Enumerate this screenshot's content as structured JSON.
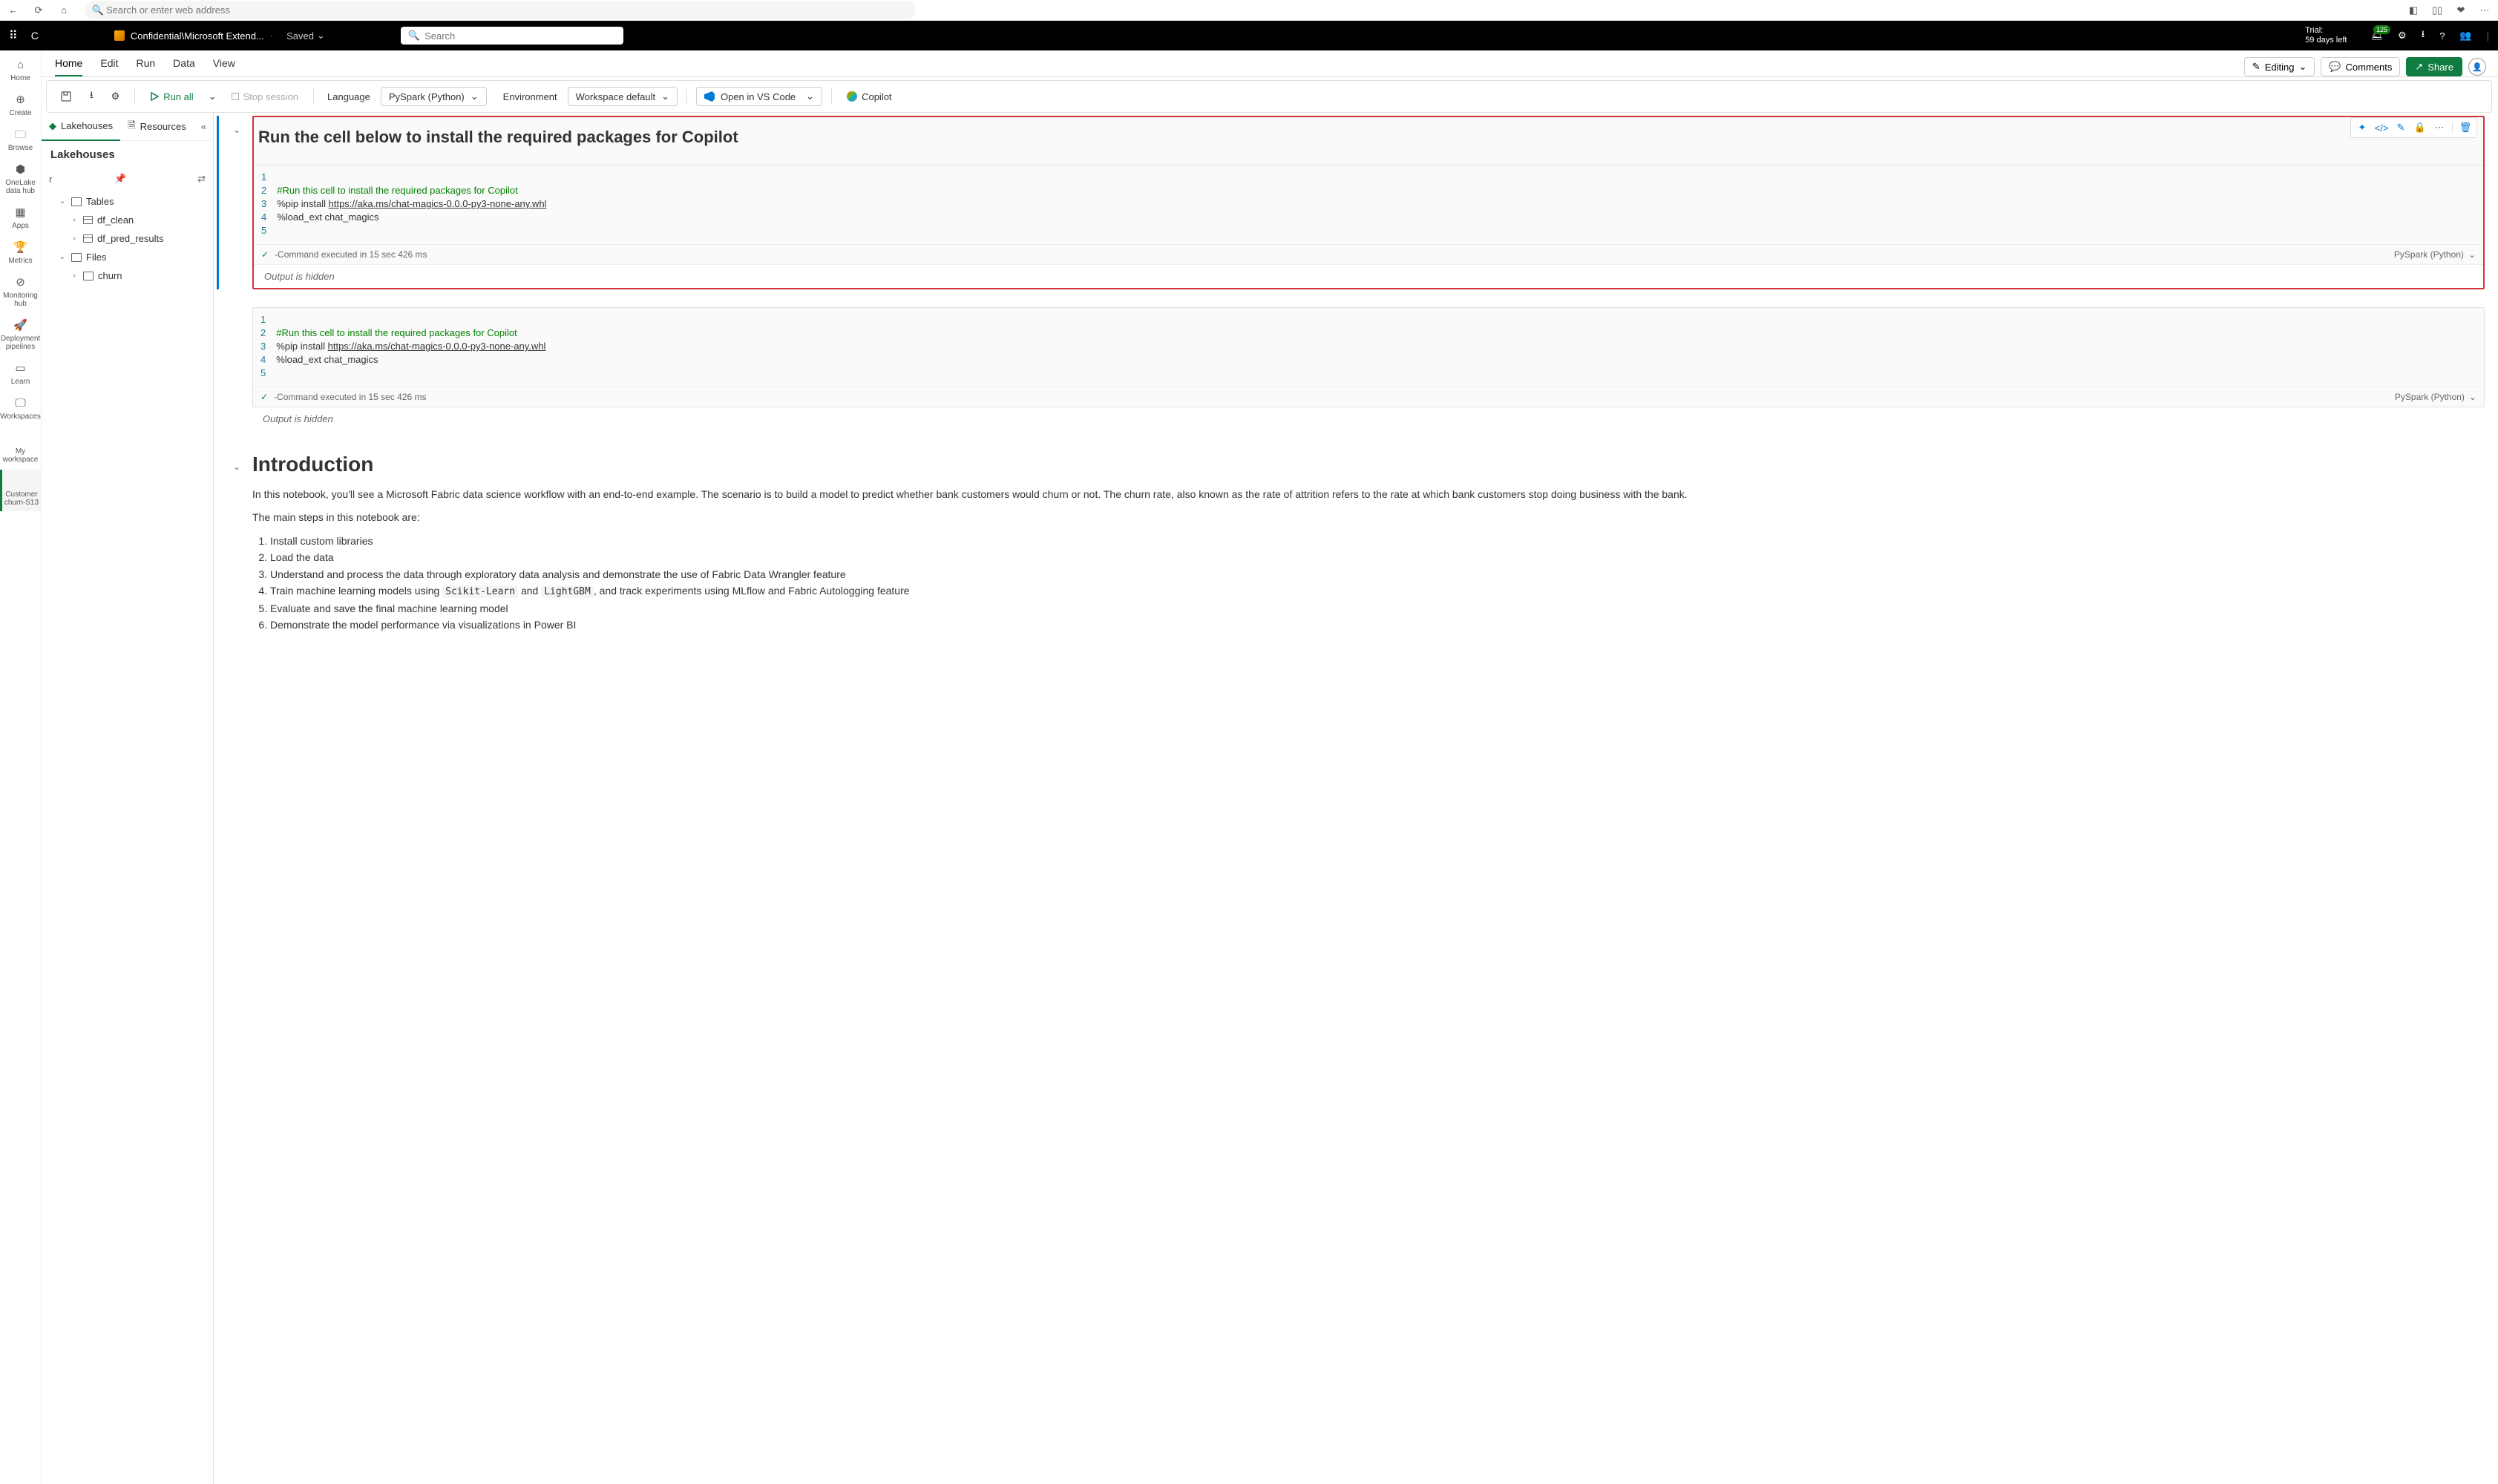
{
  "browser": {
    "search_placeholder": "Search or enter web address"
  },
  "topbar": {
    "app_letter": "C",
    "breadcrumb": "Confidential\\Microsoft Extend...",
    "saved": "Saved",
    "search_placeholder": "Search",
    "trial_line1": "Trial:",
    "trial_line2": "59 days left",
    "badge_count": "125"
  },
  "ribbon": {
    "tabs": [
      "Home",
      "Edit",
      "Run",
      "Data",
      "View"
    ],
    "editing": "Editing",
    "comments": "Comments",
    "share": "Share"
  },
  "toolbar": {
    "run_all": "Run all",
    "stop_session": "Stop session",
    "language_label": "Language",
    "language_value": "PySpark (Python)",
    "environment_label": "Environment",
    "environment_value": "Workspace default",
    "open_vscode": "Open in VS Code",
    "copilot": "Copilot"
  },
  "left_rail": [
    {
      "label": "Home",
      "icon": "home"
    },
    {
      "label": "Create",
      "icon": "plus"
    },
    {
      "label": "Browse",
      "icon": "folder"
    },
    {
      "label": "OneLake data hub",
      "icon": "db"
    },
    {
      "label": "Apps",
      "icon": "apps"
    },
    {
      "label": "Metrics",
      "icon": "metric"
    },
    {
      "label": "Monitoring hub",
      "icon": "monitor"
    },
    {
      "label": "Deployment pipelines",
      "icon": "rocket"
    },
    {
      "label": "Learn",
      "icon": "book"
    },
    {
      "label": "Workspaces",
      "icon": "screen"
    },
    {
      "label": "My workspace",
      "icon": ""
    },
    {
      "label": "Customer churn-S13",
      "icon": "code",
      "active": true
    }
  ],
  "explorer": {
    "tabs": {
      "lakehouses": "Lakehouses",
      "resources": "Resources"
    },
    "header": "Lakehouses",
    "search_value": "r",
    "tree": {
      "tables": "Tables",
      "df_clean": "df_clean",
      "df_pred": "df_pred_results",
      "files": "Files",
      "churn": "churn"
    }
  },
  "notebook": {
    "md1_title": "Run the cell below to install the required packages for Copilot",
    "cell1": {
      "lines": [
        "",
        "#Run this cell to install the required packages for Copilot",
        "%pip install ",
        "https://aka.ms/chat-magics-0.0.0-py3-none-any.whl",
        "%load_ext chat_magics",
        ""
      ],
      "status": "-Command executed in 15 sec 426 ms",
      "lang": "PySpark (Python)",
      "output": "Output is hidden"
    },
    "cell2": {
      "status": "-Command executed in 15 sec 426 ms",
      "lang": "PySpark (Python)",
      "output": "Output is hidden"
    },
    "intro": {
      "title": "Introduction",
      "p1": "In this notebook, you'll see a Microsoft Fabric data science workflow with an end-to-end example. The scenario is to build a model to predict whether bank customers would churn or not. The churn rate, also known as the rate of attrition refers to the rate at which bank customers stop doing business with the bank.",
      "p2": "The main steps in this notebook are:",
      "steps": [
        "Install custom libraries",
        "Load the data",
        "Understand and process the data through exploratory data analysis and demonstrate the use of Fabric Data Wrangler feature",
        "Train machine learning models using ",
        " and ",
        ", and track experiments using MLflow and Fabric Autologging feature",
        "Evaluate and save the final machine learning model",
        "Demonstrate the model performance via visualizations in Power BI"
      ],
      "code1": "Scikit-Learn",
      "code2": "LightGBM"
    }
  }
}
